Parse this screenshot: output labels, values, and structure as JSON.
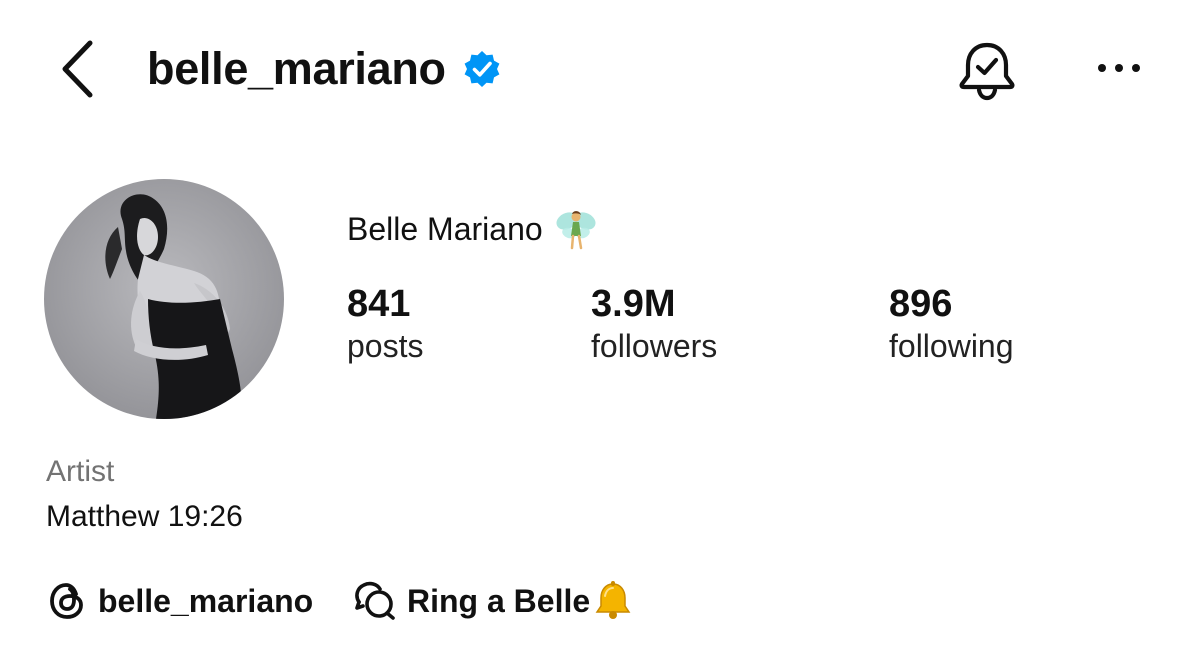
{
  "header": {
    "username": "belle_mariano",
    "verified": true,
    "back_icon": "chevron-left-icon",
    "notifications_icon": "bell-check-icon",
    "more_icon": "more-horizontal-icon"
  },
  "profile": {
    "avatar_alt": "Profile picture",
    "display_name": "Belle Mariano",
    "name_emoji": "fairy-emoji",
    "stats": {
      "posts": {
        "count": "841",
        "label": "posts"
      },
      "followers": {
        "count": "3.9M",
        "label": "followers"
      },
      "following": {
        "count": "896",
        "label": "following"
      }
    },
    "category": "Artist",
    "bio": "Matthew 19:26"
  },
  "links": {
    "threads_handle": "belle_mariano",
    "channel_label": "Ring a Belle",
    "channel_emoji": "bell-emoji"
  },
  "colors": {
    "text": "#111111",
    "muted": "#737373",
    "verified_blue": "#0095f6",
    "background": "#ffffff"
  }
}
